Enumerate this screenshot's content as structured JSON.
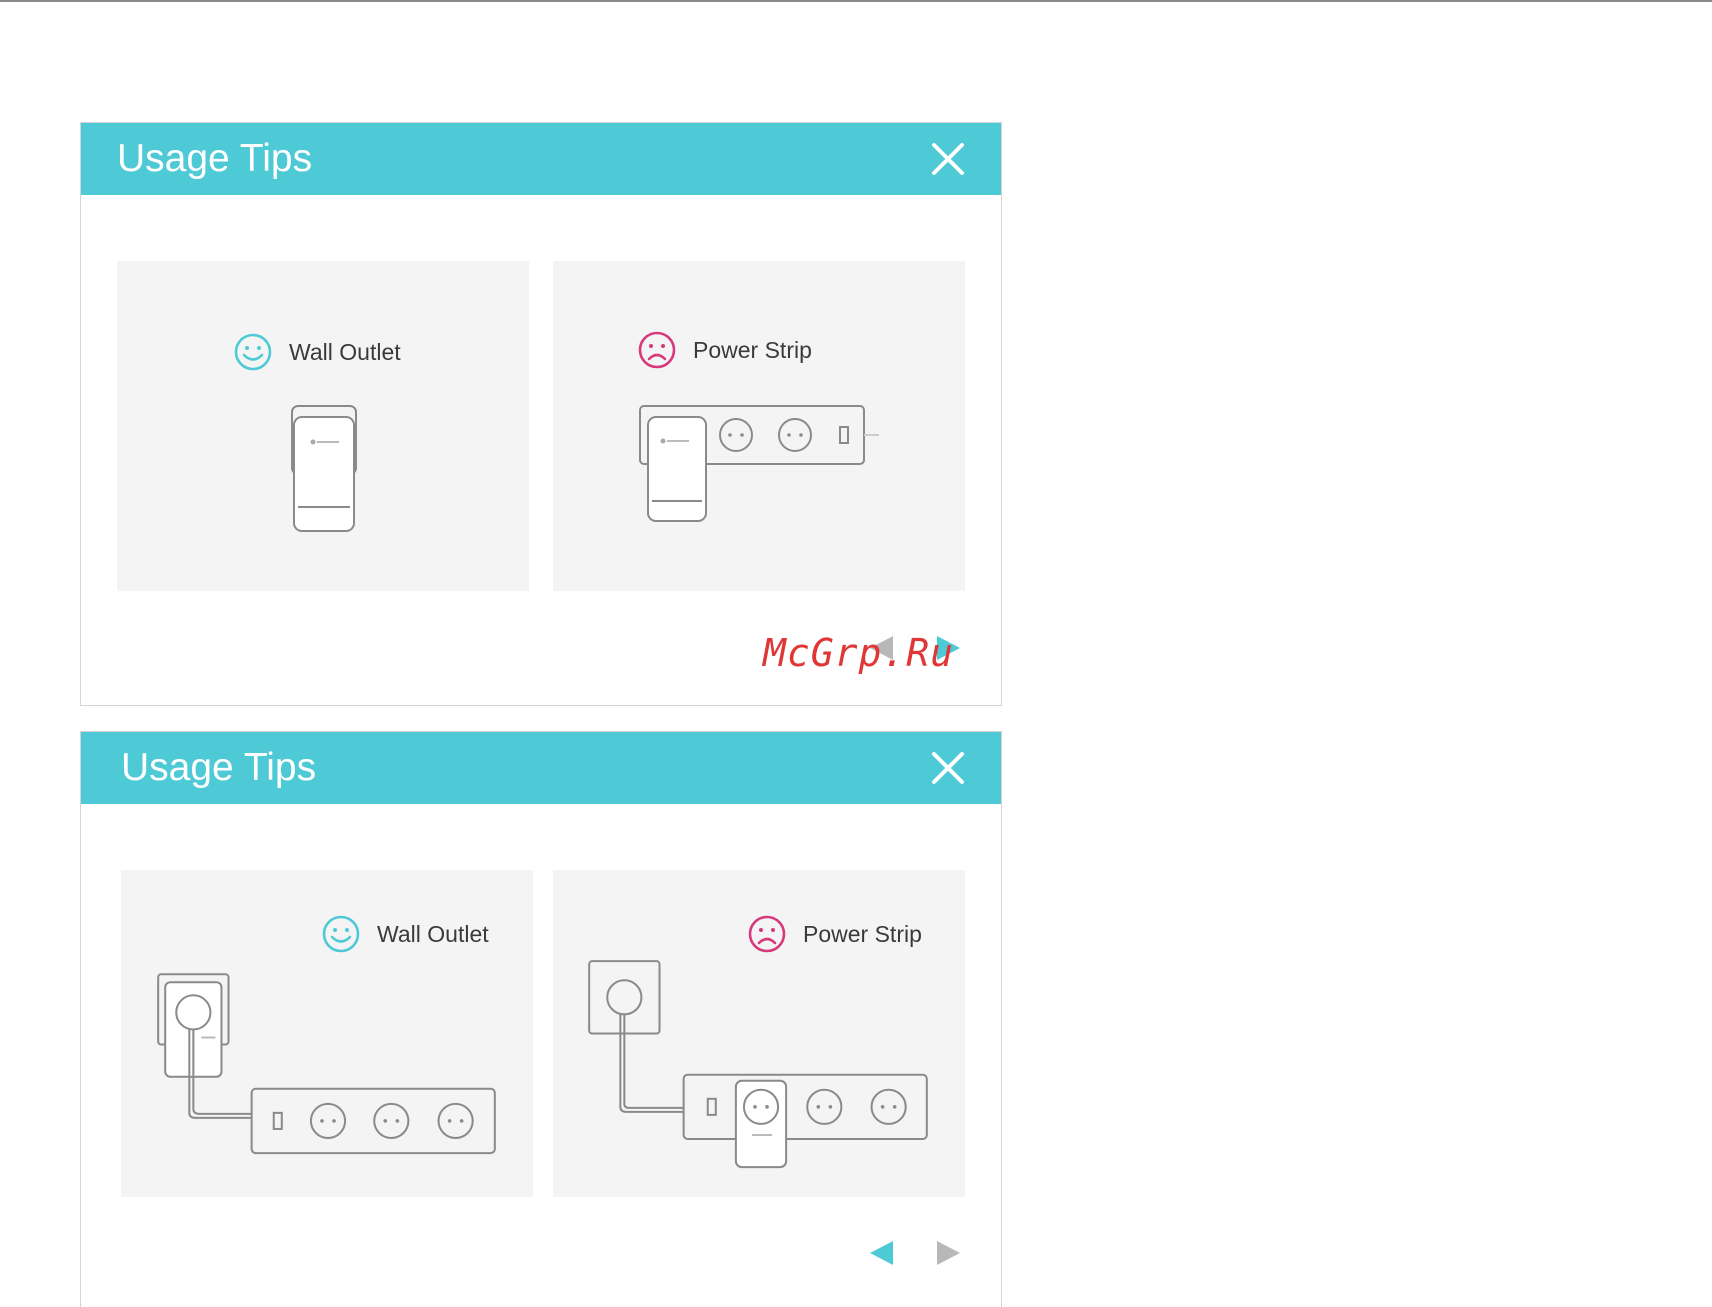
{
  "colors": {
    "header": "#4dcad6",
    "good": "#4dcad6",
    "bad": "#d63a7d",
    "panel": "#f4f4f4"
  },
  "dialogs": [
    {
      "title": "Usage Tips",
      "close_icon": "close-icon",
      "good_panel": {
        "label": "Wall Outlet",
        "icon": "smiley-happy-icon"
      },
      "bad_panel": {
        "label": "Power Strip",
        "icon": "smiley-sad-icon"
      },
      "prev_state": "disabled",
      "next_state": "active",
      "watermark": "McGrp.Ru"
    },
    {
      "title": "Usage Tips",
      "close_icon": "close-icon",
      "good_panel": {
        "label": "Wall Outlet",
        "icon": "smiley-happy-icon"
      },
      "bad_panel": {
        "label": "Power Strip",
        "icon": "smiley-sad-icon"
      },
      "prev_state": "active",
      "next_state": "disabled"
    }
  ]
}
